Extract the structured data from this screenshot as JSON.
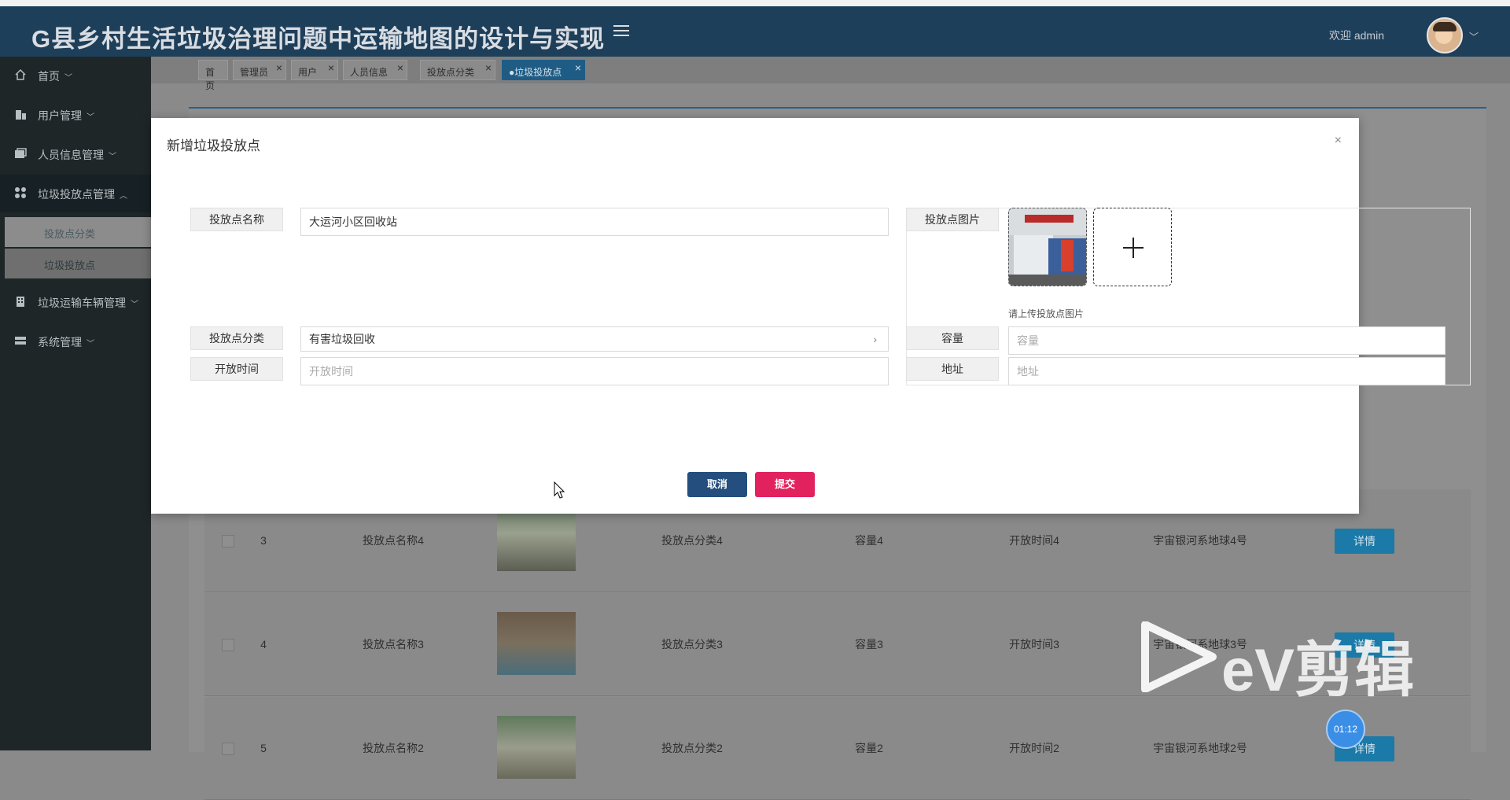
{
  "app": {
    "title": "G县乡村生活垃圾治理问题中运输地图的设计与实现",
    "welcome": "欢迎 admin"
  },
  "sidebar": {
    "items": [
      {
        "label": "首页",
        "icon": "home-icon"
      },
      {
        "label": "用户管理",
        "icon": "building-icon"
      },
      {
        "label": "人员信息管理",
        "icon": "folder-icon"
      },
      {
        "label": "垃圾投放点管理",
        "icon": "grid-icon"
      },
      {
        "label": "垃圾运输车辆管理",
        "icon": "building-icon"
      },
      {
        "label": "系统管理",
        "icon": "server-icon"
      }
    ],
    "sub_items": [
      {
        "label": "投放点分类"
      },
      {
        "label": "垃圾投放点"
      }
    ]
  },
  "tabs": [
    {
      "label": "首页"
    },
    {
      "label": "管理员"
    },
    {
      "label": "用户"
    },
    {
      "label": "人员信息"
    },
    {
      "label": "投放点分类"
    },
    {
      "label": "●垃圾投放点"
    }
  ],
  "table": {
    "rows": [
      {
        "index": "3",
        "name": "投放点名称4",
        "category": "投放点分类4",
        "capacity": "容量4",
        "open_time": "开放时间4",
        "address": "宇宙银河系地球4号",
        "action": "详情"
      },
      {
        "index": "4",
        "name": "投放点名称3",
        "category": "投放点分类3",
        "capacity": "容量3",
        "open_time": "开放时间3",
        "address": "宇宙银河系地球3号",
        "action": "详情"
      },
      {
        "index": "5",
        "name": "投放点名称2",
        "category": "投放点分类2",
        "capacity": "容量2",
        "open_time": "开放时间2",
        "address": "宇宙银河系地球2号",
        "action": "详情"
      }
    ]
  },
  "modal": {
    "title": "新增垃圾投放点",
    "close": "×",
    "fields": {
      "name_label": "投放点名称",
      "name_value": "大运河小区回收站",
      "image_label": "投放点图片",
      "upload_hint": "请上传投放点图片",
      "category_label": "投放点分类",
      "category_value": "有害垃圾回收",
      "capacity_label": "容量",
      "capacity_placeholder": "容量",
      "open_time_label": "开放时间",
      "open_time_placeholder": "开放时间",
      "address_label": "地址",
      "address_placeholder": "地址"
    },
    "buttons": {
      "cancel": "取消",
      "submit": "提交"
    }
  },
  "overlay": {
    "watermark": "eV剪辑",
    "timer": "01:12"
  }
}
